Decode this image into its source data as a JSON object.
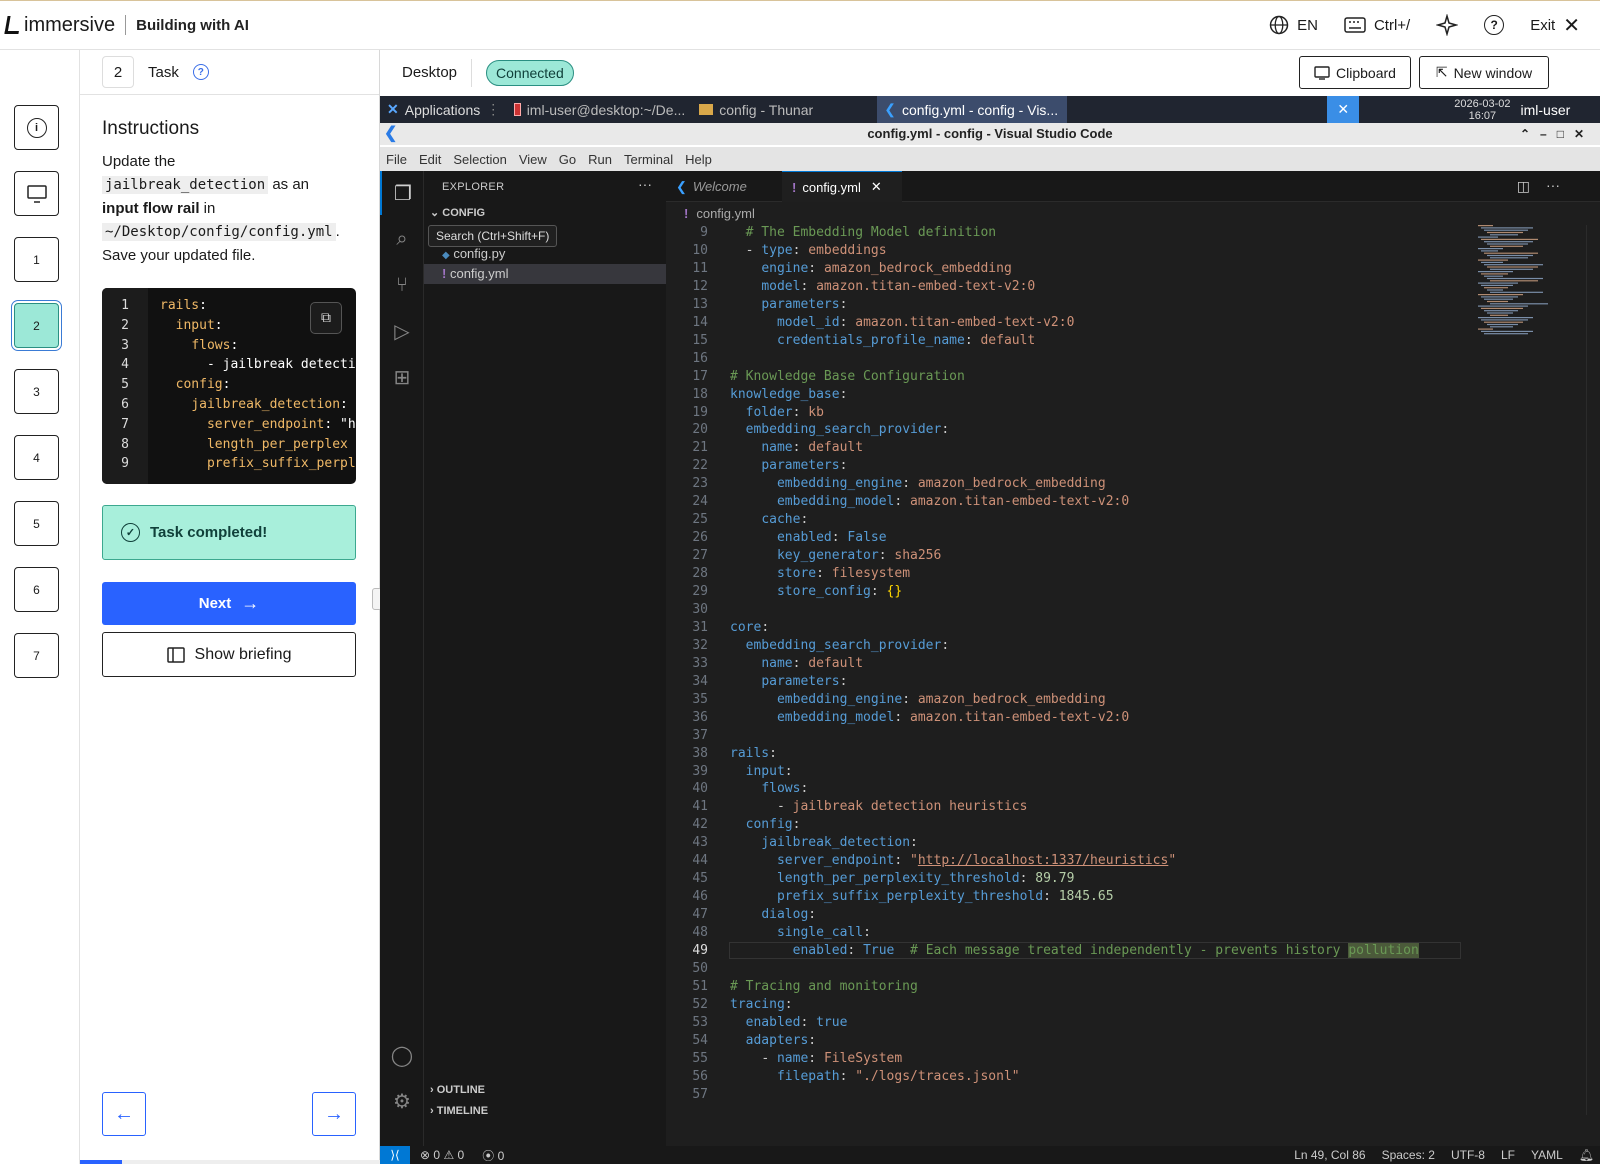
{
  "header": {
    "brand": "immersive",
    "course": "Building with AI",
    "language": "EN",
    "shortcut": "Ctrl+/",
    "exit_label": "Exit"
  },
  "rail": {
    "steps": [
      "1",
      "2",
      "3",
      "4",
      "5",
      "6",
      "7"
    ],
    "active_step": "2"
  },
  "panel": {
    "step_number": "2",
    "title": "Task",
    "instructions_heading": "Instructions",
    "instr_1": "Update the",
    "instr_code_1": "jailbreak_detection",
    "instr_2": "as an",
    "instr_bold": "input flow rail",
    "instr_3": "in",
    "instr_code_2": "~/Desktop/config/config.yml",
    "instr_4": ". Save your updated file.",
    "snippet_lines": [
      {
        "n": "1",
        "t": "rails:"
      },
      {
        "n": "2",
        "t": "  input:"
      },
      {
        "n": "3",
        "t": "    flows:"
      },
      {
        "n": "4",
        "t": "      - jailbreak detecti"
      },
      {
        "n": "5",
        "t": "  config:"
      },
      {
        "n": "6",
        "t": "    jailbreak_detection:"
      },
      {
        "n": "7",
        "t": "      server_endpoint: \"h"
      },
      {
        "n": "8",
        "t": "      length_per_perplex"
      },
      {
        "n": "9",
        "t": "      prefix_suffix_perpl"
      }
    ],
    "completed_label": "Task completed!",
    "next_label": "Next",
    "briefing_label": "Show briefing",
    "progress": 0.14
  },
  "desktop": {
    "title": "Desktop",
    "status": "Connected",
    "clipboard_label": "Clipboard",
    "new_window_label": "New window"
  },
  "taskbar": {
    "apps_label": "Applications",
    "items": [
      "iml-user@desktop:~/De...",
      "config - Thunar",
      "config.yml - config - Vis..."
    ],
    "date": "2026-03-02",
    "time": "16:07",
    "user": "iml-user"
  },
  "vscode": {
    "window_title": "config.yml - config - Visual Studio Code",
    "menu": [
      "File",
      "Edit",
      "Selection",
      "View",
      "Go",
      "Run",
      "Terminal",
      "Help"
    ],
    "explorer_title": "EXPLORER",
    "folder": "CONFIG",
    "files": [
      "config.py",
      "config.yml"
    ],
    "tooltip": "Search (Ctrl+Shift+F)",
    "outline_label": "OUTLINE",
    "timeline_label": "TIMELINE",
    "tabs": [
      "Welcome",
      "config.yml"
    ],
    "breadcrumb": "config.yml",
    "status": {
      "errors": "0",
      "warnings": "0",
      "ports": "0",
      "position": "Ln 49, Col 86",
      "spaces": "Spaces: 2",
      "encoding": "UTF-8",
      "eol": "LF",
      "language": "YAML"
    }
  },
  "code_lines": [
    {
      "n": "9",
      "html": "  <span class='c'># The Embedding Model definition</span>"
    },
    {
      "n": "10",
      "html": "  <span class='p'>-</span> <span class='k'>type</span>: <span class='v'>embeddings</span>"
    },
    {
      "n": "11",
      "html": "    <span class='k'>engine</span>: <span class='v'>amazon_bedrock_embedding</span>"
    },
    {
      "n": "12",
      "html": "    <span class='k'>model</span>: <span class='v'>amazon.titan-embed-text-v2:0</span>"
    },
    {
      "n": "13",
      "html": "    <span class='k'>parameters</span>:"
    },
    {
      "n": "14",
      "html": "      <span class='k'>model_id</span>: <span class='v'>amazon.titan-embed-text-v2:0</span>"
    },
    {
      "n": "15",
      "html": "      <span class='k'>credentials_profile_name</span>: <span class='v'>default</span>"
    },
    {
      "n": "16",
      "html": ""
    },
    {
      "n": "17",
      "html": "<span class='c'># Knowledge Base Configuration</span>"
    },
    {
      "n": "18",
      "html": "<span class='k'>knowledge_base</span>:"
    },
    {
      "n": "19",
      "html": "  <span class='k'>folder</span>: <span class='v'>kb</span>"
    },
    {
      "n": "20",
      "html": "  <span class='k'>embedding_search_provider</span>:"
    },
    {
      "n": "21",
      "html": "    <span class='k'>name</span>: <span class='v'>default</span>"
    },
    {
      "n": "22",
      "html": "    <span class='k'>parameters</span>:"
    },
    {
      "n": "23",
      "html": "      <span class='k'>embedding_engine</span>: <span class='v'>amazon_bedrock_embedding</span>"
    },
    {
      "n": "24",
      "html": "      <span class='k'>embedding_model</span>: <span class='v'>amazon.titan-embed-text-v2:0</span>"
    },
    {
      "n": "25",
      "html": "    <span class='k'>cache</span>:"
    },
    {
      "n": "26",
      "html": "      <span class='k'>enabled</span>: <span class='b'>False</span>"
    },
    {
      "n": "27",
      "html": "      <span class='k'>key_generator</span>: <span class='v'>sha256</span>"
    },
    {
      "n": "28",
      "html": "      <span class='k'>store</span>: <span class='v'>filesystem</span>"
    },
    {
      "n": "29",
      "html": "      <span class='k'>store_config</span>: <span class='br'>{}</span>"
    },
    {
      "n": "30",
      "html": ""
    },
    {
      "n": "31",
      "html": "<span class='k'>core</span>:"
    },
    {
      "n": "32",
      "html": "  <span class='k'>embedding_search_provider</span>:"
    },
    {
      "n": "33",
      "html": "    <span class='k'>name</span>: <span class='v'>default</span>"
    },
    {
      "n": "34",
      "html": "    <span class='k'>parameters</span>:"
    },
    {
      "n": "35",
      "html": "      <span class='k'>embedding_engine</span>: <span class='v'>amazon_bedrock_embedding</span>"
    },
    {
      "n": "36",
      "html": "      <span class='k'>embedding_model</span>: <span class='v'>amazon.titan-embed-text-v2:0</span>"
    },
    {
      "n": "37",
      "html": ""
    },
    {
      "n": "38",
      "html": "<span class='k'>rails</span>:"
    },
    {
      "n": "39",
      "html": "  <span class='k'>input</span>:"
    },
    {
      "n": "40",
      "html": "    <span class='k'>flows</span>:"
    },
    {
      "n": "41",
      "html": "      <span class='p'>-</span> <span class='v'>jailbreak detection heuristics</span>"
    },
    {
      "n": "42",
      "html": "  <span class='k'>config</span>:"
    },
    {
      "n": "43",
      "html": "    <span class='k'>jailbreak_detection</span>:"
    },
    {
      "n": "44",
      "html": "      <span class='k'>server_endpoint</span>: <span class='v'>\"<u>http://localhost:1337/heuristics</u>\"</span>"
    },
    {
      "n": "45",
      "html": "      <span class='k'>length_per_perplexity_threshold</span>: <span class='n'>89.79</span>"
    },
    {
      "n": "46",
      "html": "      <span class='k'>prefix_suffix_perplexity_threshold</span>: <span class='n'>1845.65</span>"
    },
    {
      "n": "47",
      "html": "    <span class='k'>dialog</span>:"
    },
    {
      "n": "48",
      "html": "      <span class='k'>single_call</span>:"
    },
    {
      "n": "49",
      "html": "        <span class='k'>enabled</span>: <span class='b'>True</span>  <span class='c'># Each message treated independently - prevents history <span style='background:#4b5a3a'>pollution</span></span>"
    },
    {
      "n": "50",
      "html": ""
    },
    {
      "n": "51",
      "html": "<span class='c'># Tracing and monitoring</span>"
    },
    {
      "n": "52",
      "html": "<span class='k'>tracing</span>:"
    },
    {
      "n": "53",
      "html": "  <span class='k'>enabled</span>: <span class='b'>true</span>"
    },
    {
      "n": "54",
      "html": "  <span class='k'>adapters</span>:"
    },
    {
      "n": "55",
      "html": "    <span class='p'>-</span> <span class='k'>name</span>: <span class='v'>FileSystem</span>"
    },
    {
      "n": "56",
      "html": "      <span class='k'>filepath</span>: <span class='v'>\"./logs/traces.jsonl\"</span>"
    },
    {
      "n": "57",
      "html": ""
    }
  ],
  "current_line": "49"
}
